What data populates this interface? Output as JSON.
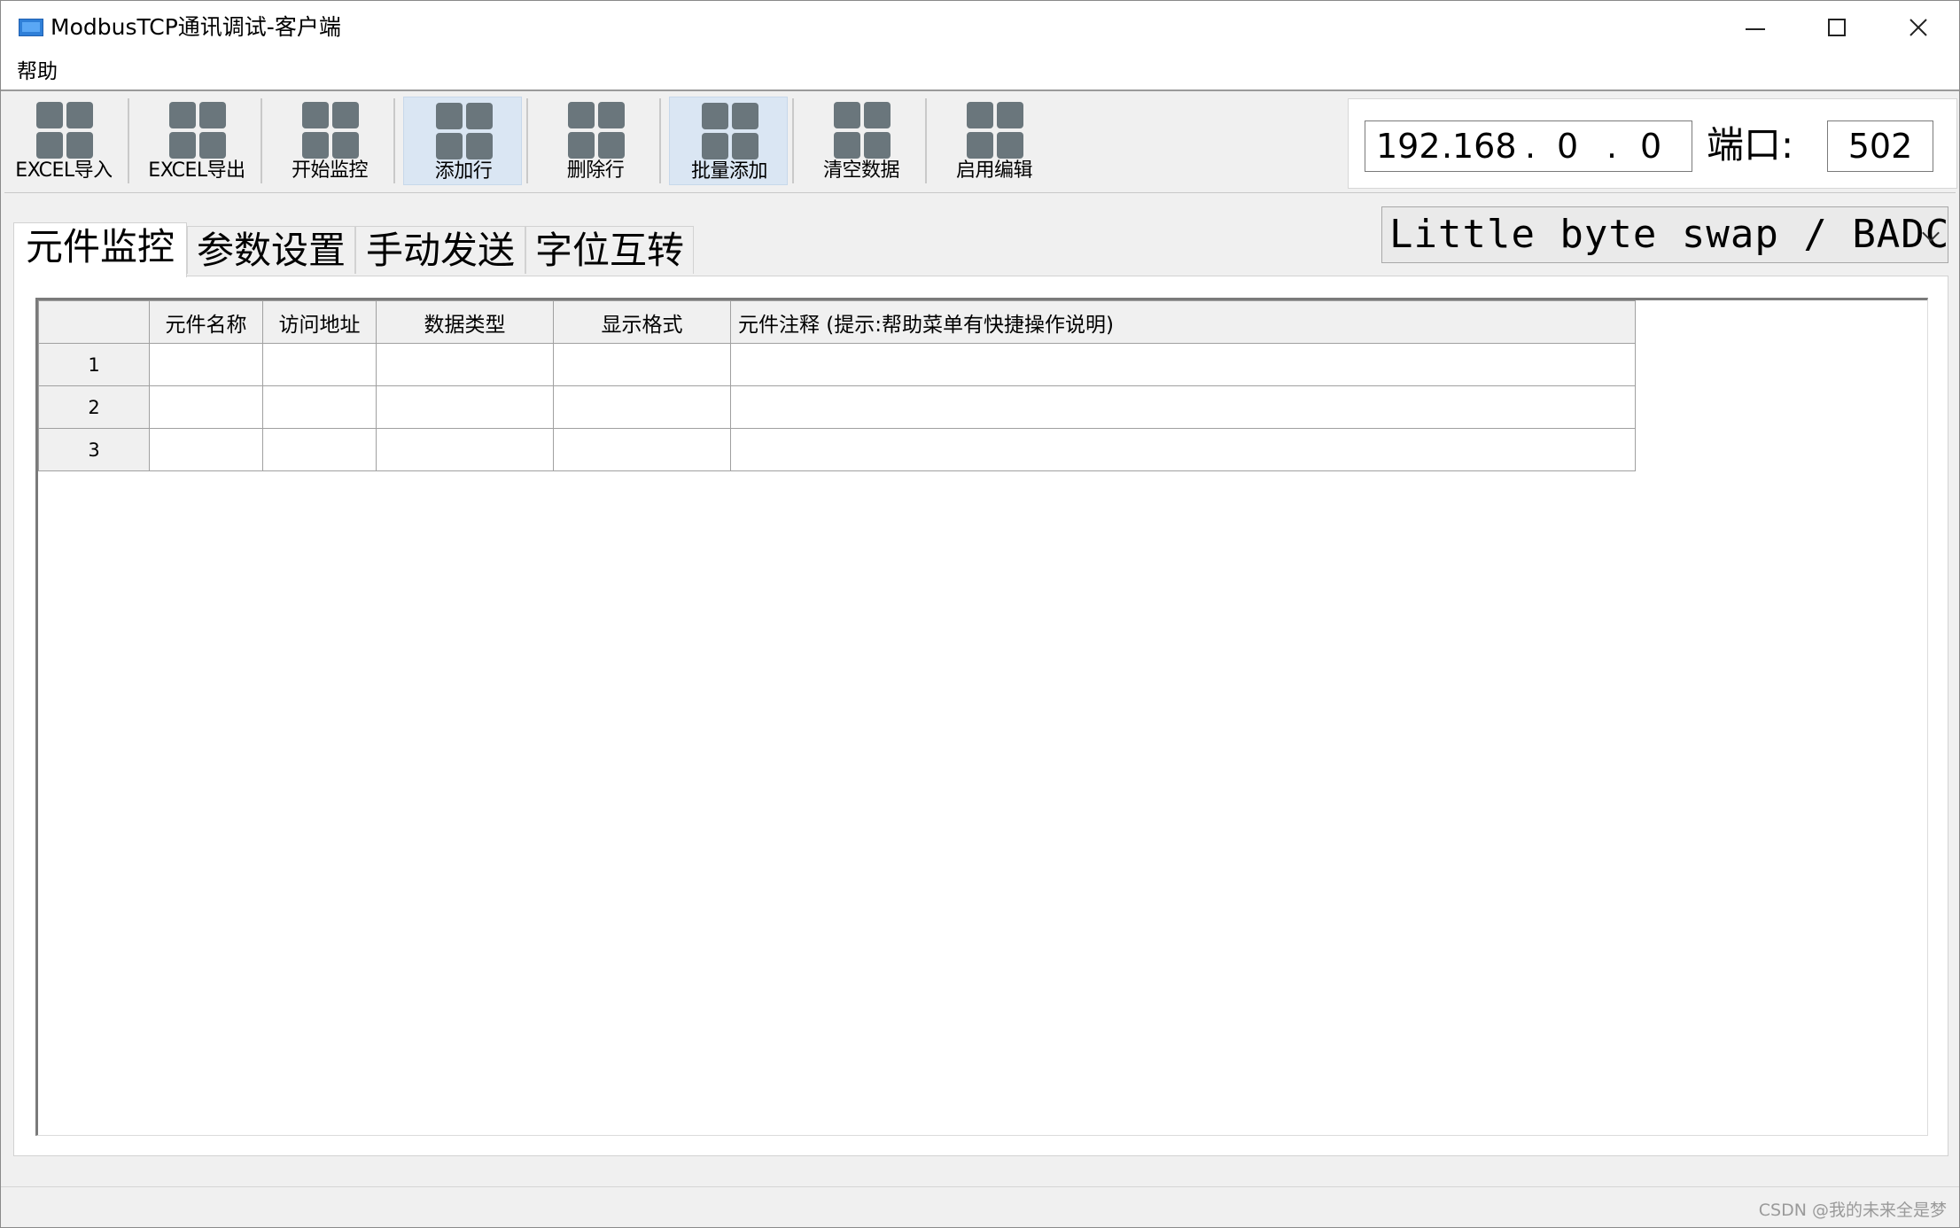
{
  "window": {
    "title": "ModbusTCP通讯调试-客户端"
  },
  "menu": {
    "items": [
      "帮助"
    ]
  },
  "toolbar": {
    "buttons": [
      {
        "label": "EXCEL导入"
      },
      {
        "label": "EXCEL导出"
      },
      {
        "label": "开始监控"
      },
      {
        "label": "添加行"
      },
      {
        "label": "删除行"
      },
      {
        "label": "批量添加"
      },
      {
        "label": "清空数据"
      },
      {
        "label": "启用编辑"
      }
    ]
  },
  "connection": {
    "ip": [
      "192",
      "168",
      "0",
      "0"
    ],
    "port_label": "端口:",
    "port": "502"
  },
  "tabs": [
    "元件监控",
    "参数设置",
    "手动发送",
    "字位互转"
  ],
  "byte_order": {
    "selected": "Little byte swap / BADC"
  },
  "table": {
    "columns": [
      "元件名称",
      "访问地址",
      "数据类型",
      "显示格式",
      "元件注释 (提示:帮助菜单有快捷操作说明)"
    ],
    "rows": [
      {
        "index": "1",
        "cells": [
          "",
          "",
          "",
          "",
          ""
        ]
      },
      {
        "index": "2",
        "cells": [
          "",
          "",
          "",
          "",
          ""
        ]
      },
      {
        "index": "3",
        "cells": [
          "",
          "",
          "",
          "",
          ""
        ]
      }
    ]
  },
  "watermark": "CSDN @我的未来全是梦",
  "colors": {
    "toolbar_highlight": "#dae6f3",
    "icon_gray": "#6a767c",
    "app_icon_blue": "#2f7fd8"
  }
}
